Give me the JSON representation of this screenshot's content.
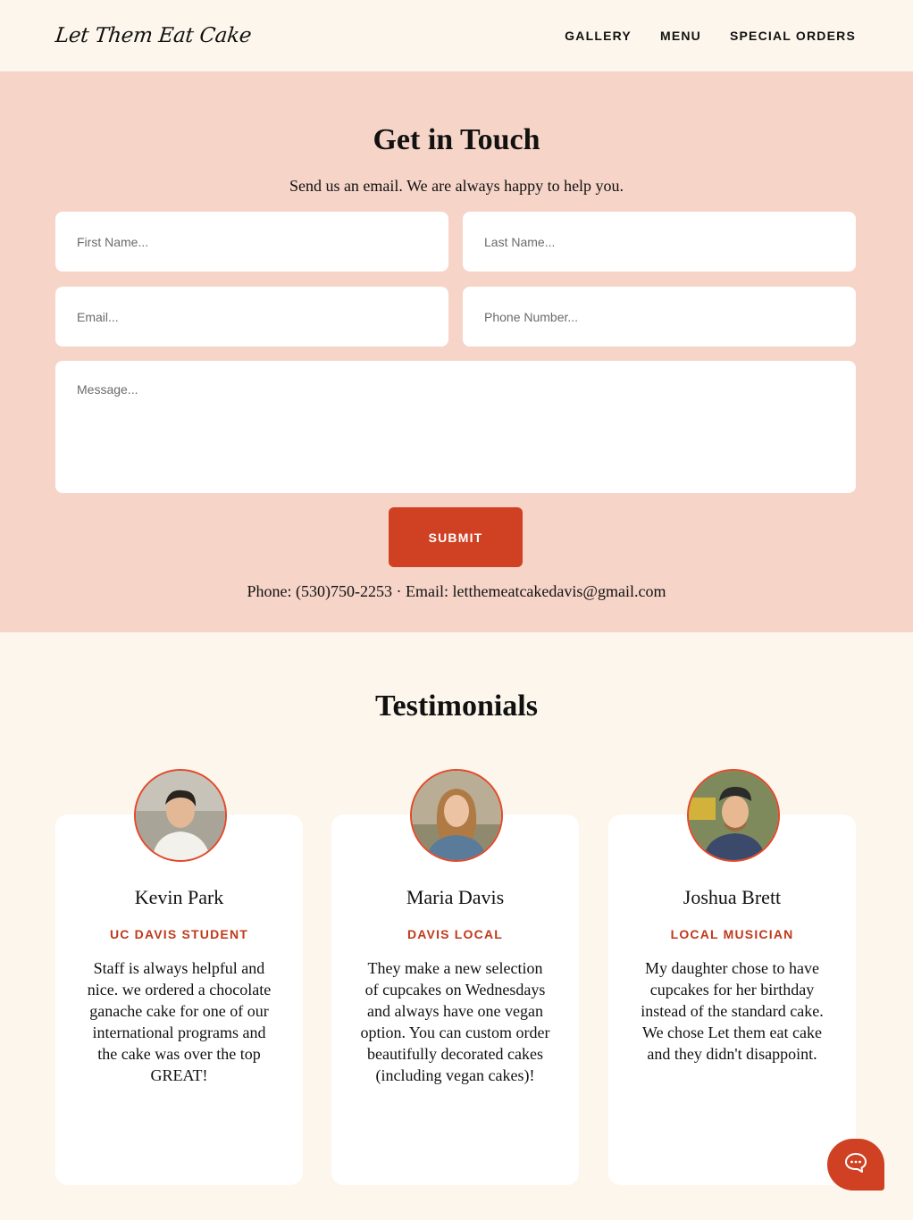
{
  "header": {
    "logo": "Let Them Eat Cake",
    "nav": [
      "GALLERY",
      "MENU",
      "SPECIAL ORDERS"
    ]
  },
  "contact": {
    "title": "Get in Touch",
    "subtitle": "Send us an email. We are always happy to help you.",
    "placeholders": {
      "first_name": "First Name...",
      "last_name": "Last Name...",
      "email": "Email...",
      "phone": "Phone Number...",
      "message": "Message..."
    },
    "submit_label": "SUBMIT",
    "contact_line": "Phone: (530)750-2253 · Email: letthemeatcakedavis@gmail.com"
  },
  "testimonials": {
    "title": "Testimonials",
    "items": [
      {
        "name": "Kevin Park",
        "role": "UC DAVIS STUDENT",
        "quote": "Staff is always helpful and nice. we ordered a chocolate ganache cake for one of our international programs and the cake was over the top GREAT!"
      },
      {
        "name": "Maria Davis",
        "role": "DAVIS LOCAL",
        "quote": "They make a new selection of cupcakes on Wednesdays and always have one vegan option. You can custom order beautifully decorated cakes (including vegan cakes)!"
      },
      {
        "name": "Joshua Brett",
        "role": "LOCAL MUSICIAN",
        "quote": "My daughter chose to have cupcakes for her birthday instead of the standard cake. We chose Let them eat cake and they didn't disappoint."
      }
    ]
  },
  "chat": {
    "icon": "chat-bubble-icon"
  },
  "colors": {
    "background": "#fdf6ec",
    "contact_bg": "#f6d4c8",
    "accent": "#cf4122",
    "role_text": "#c0391b"
  }
}
